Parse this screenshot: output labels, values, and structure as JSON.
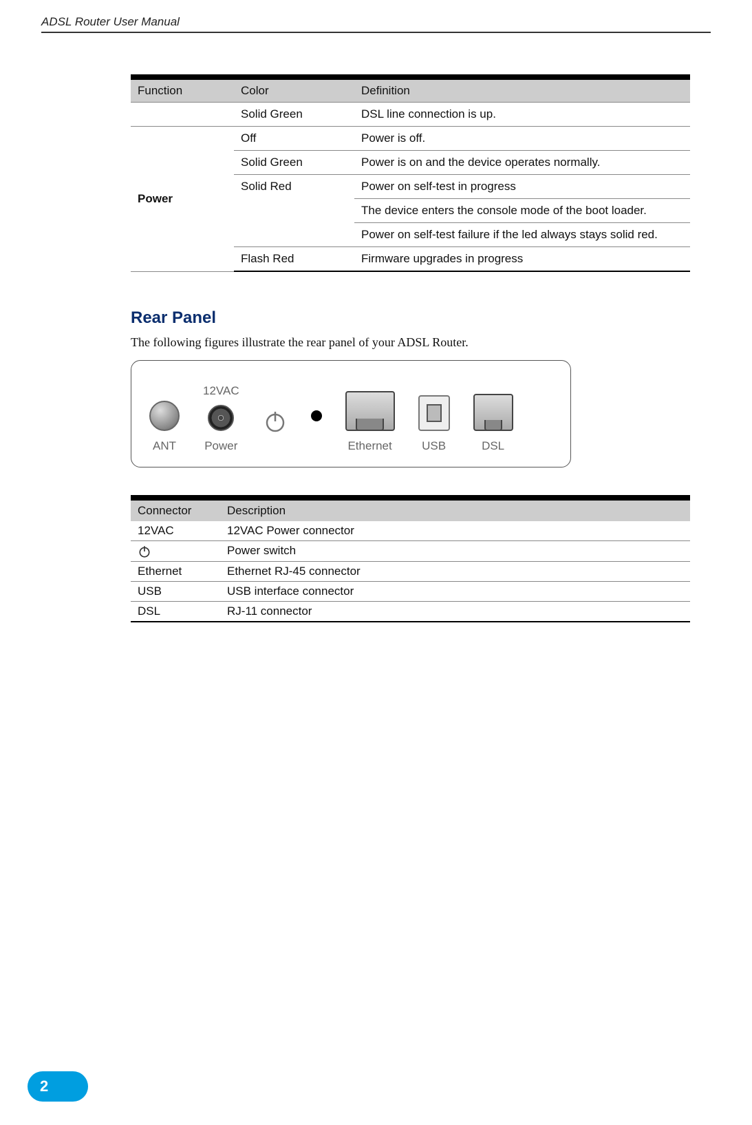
{
  "doc_title": "ADSL Router User Manual",
  "page_number": "2",
  "led_table": {
    "headers": {
      "function": "Function",
      "color": "Color",
      "definition": "Definition"
    },
    "first_row": {
      "function": "",
      "color": "Solid Green",
      "definition": "DSL line connection is up."
    },
    "power_label": "Power",
    "rows": [
      {
        "color": "Off",
        "definition": "Power is off."
      },
      {
        "color": "Solid Green",
        "definition": "Power is on and the device operates normally."
      },
      {
        "color": "Solid Red",
        "definition": "Power on self-test in progress"
      },
      {
        "color": "",
        "definition": "The device enters the console mode of the boot loader."
      },
      {
        "color": "",
        "definition": "Power on self-test failure if the led always stays solid red."
      },
      {
        "color": "Flash Red",
        "definition": "Firmware upgrades in progress"
      }
    ]
  },
  "section_heading": "Rear Panel",
  "section_intro": "The following figures illustrate the rear panel of your ADSL Router.",
  "rear_panel_labels": {
    "ant": "ANT",
    "dc": "12VAC",
    "power_lbl": "Power",
    "ethernet": "Ethernet",
    "usb": "USB",
    "dsl": "DSL"
  },
  "conn_table": {
    "headers": {
      "connector": "Connector",
      "description": "Description"
    },
    "rows": [
      {
        "connector": "12VAC",
        "description": "12VAC Power connector"
      },
      {
        "connector": "__POWER_ICON__",
        "description": "Power switch"
      },
      {
        "connector": "Ethernet",
        "description": "Ethernet RJ-45 connector"
      },
      {
        "connector": "USB",
        "description": "USB interface connector"
      },
      {
        "connector": "DSL",
        "description": "RJ-11 connector"
      }
    ]
  }
}
